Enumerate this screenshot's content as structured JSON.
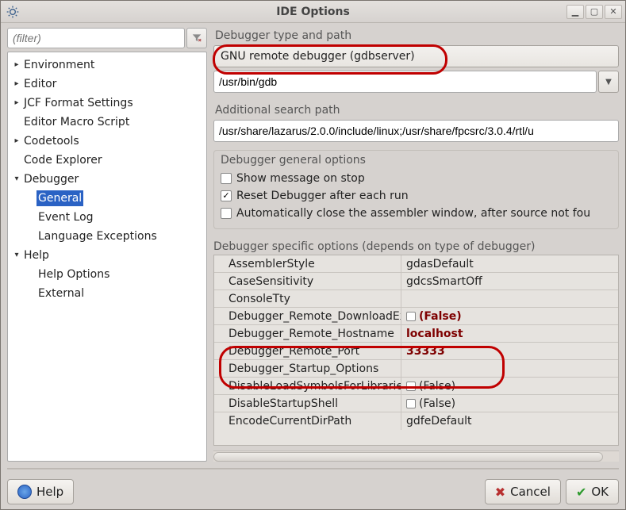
{
  "window": {
    "title": "IDE Options"
  },
  "filter": {
    "placeholder": "(filter)"
  },
  "tree": [
    {
      "label": "Environment",
      "level": 1,
      "expander": "▸",
      "selected": false
    },
    {
      "label": "Editor",
      "level": 1,
      "expander": "▸",
      "selected": false
    },
    {
      "label": "JCF Format Settings",
      "level": 1,
      "expander": "▸",
      "selected": false
    },
    {
      "label": "Editor Macro Script",
      "level": 1,
      "expander": "",
      "selected": false
    },
    {
      "label": "Codetools",
      "level": 1,
      "expander": "▸",
      "selected": false
    },
    {
      "label": "Code Explorer",
      "level": 1,
      "expander": "",
      "selected": false
    },
    {
      "label": "Debugger",
      "level": 1,
      "expander": "▾",
      "selected": false
    },
    {
      "label": "General",
      "level": 2,
      "expander": "",
      "selected": true
    },
    {
      "label": "Event Log",
      "level": 2,
      "expander": "",
      "selected": false
    },
    {
      "label": "Language Exceptions",
      "level": 2,
      "expander": "",
      "selected": false
    },
    {
      "label": "Help",
      "level": 1,
      "expander": "▾",
      "selected": false
    },
    {
      "label": "Help Options",
      "level": 2,
      "expander": "",
      "selected": false
    },
    {
      "label": "External",
      "level": 2,
      "expander": "",
      "selected": false
    }
  ],
  "right": {
    "type_path_label": "Debugger type and path",
    "debugger_type": "GNU remote debugger (gdbserver)",
    "debugger_path": "/usr/bin/gdb",
    "addl_path_label": "Additional search path",
    "addl_path_value": "/usr/share/lazarus/2.0.0/include/linux;/usr/share/fpcsrc/3.0.4/rtl/u",
    "general_title": "Debugger general options",
    "chk1": "Show message on stop",
    "chk2": "Reset Debugger after each run",
    "chk3": "Automatically close the assembler window, after source not fou",
    "specific_title": "Debugger specific options (depends on type of debugger)",
    "grid": [
      {
        "name": "AssemblerStyle",
        "value": "gdasDefault",
        "chk": false,
        "hl": false
      },
      {
        "name": "CaseSensitivity",
        "value": "gdcsSmartOff",
        "chk": false,
        "hl": false
      },
      {
        "name": "ConsoleTty",
        "value": "",
        "chk": false,
        "hl": false
      },
      {
        "name": "Debugger_Remote_DownloadEx",
        "value": "(False)",
        "chk": true,
        "hl": true
      },
      {
        "name": "Debugger_Remote_Hostname",
        "value": "localhost",
        "chk": false,
        "hl": true
      },
      {
        "name": "Debugger_Remote_Port",
        "value": "33333",
        "chk": false,
        "hl": true
      },
      {
        "name": "Debugger_Startup_Options",
        "value": "",
        "chk": false,
        "hl": false
      },
      {
        "name": "DisableLoadSymbolsForLibraries",
        "value": "(False)",
        "chk": true,
        "hl": false
      },
      {
        "name": "DisableStartupShell",
        "value": "(False)",
        "chk": true,
        "hl": false
      },
      {
        "name": "EncodeCurrentDirPath",
        "value": "gdfeDefault",
        "chk": false,
        "hl": false
      }
    ]
  },
  "footer": {
    "help": "Help",
    "cancel": "Cancel",
    "ok": "OK"
  }
}
